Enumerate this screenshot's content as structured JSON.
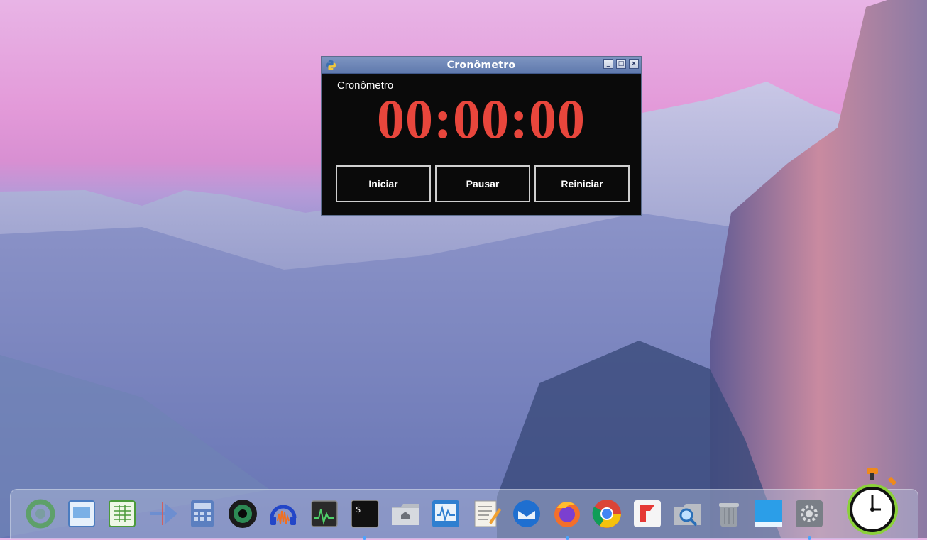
{
  "window": {
    "title": "Cronômetro",
    "app_label": "Cronômetro",
    "time": "00:00:00",
    "controls": {
      "minimize": "_",
      "maximize": "□",
      "close": "×"
    },
    "buttons": {
      "start": "Iniciar",
      "pause": "Pausar",
      "reset": "Reiniciar"
    }
  },
  "colors": {
    "clock": "#e8463c",
    "window_bg": "#0a0a0a",
    "titlebar": "#6d85b8"
  },
  "dock": {
    "items": [
      {
        "name": "launcher-icon"
      },
      {
        "name": "image-viewer-icon"
      },
      {
        "name": "spreadsheet-icon"
      },
      {
        "name": "arrow-tool-icon"
      },
      {
        "name": "calculator-icon"
      },
      {
        "name": "camera-lens-icon"
      },
      {
        "name": "audio-editor-icon"
      },
      {
        "name": "system-monitor-icon"
      },
      {
        "name": "terminal-icon"
      },
      {
        "name": "home-folder-icon"
      },
      {
        "name": "activity-monitor-icon"
      },
      {
        "name": "text-editor-icon"
      },
      {
        "name": "mail-client-icon"
      },
      {
        "name": "firefox-icon"
      },
      {
        "name": "chrome-icon"
      },
      {
        "name": "flathub-icon"
      },
      {
        "name": "file-search-icon"
      },
      {
        "name": "trash-icon"
      },
      {
        "name": "desktop-icon"
      },
      {
        "name": "settings-icon"
      },
      {
        "name": "stopwatch-icon"
      }
    ]
  }
}
